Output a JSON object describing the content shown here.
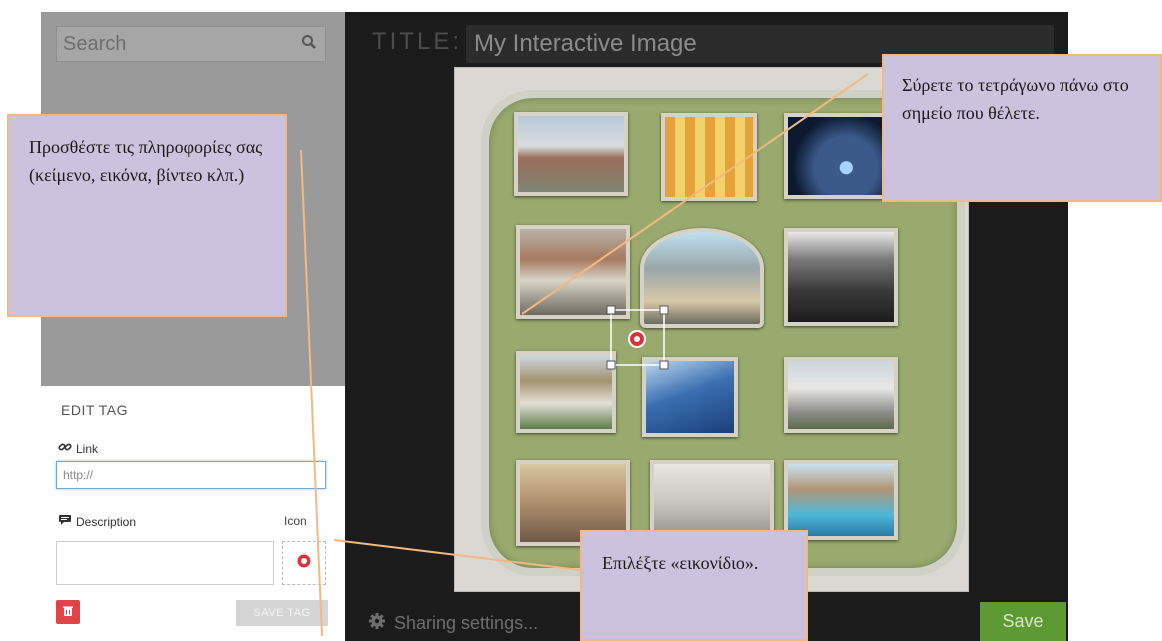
{
  "search": {
    "placeholder": "Search",
    "icon": "search-icon"
  },
  "edit_tag": {
    "heading": "EDIT TAG",
    "link_label": "Link",
    "link_value": "http://",
    "description_label": "Description",
    "description_value": "",
    "icon_label": "Icon",
    "save_label": "SAVE TAG"
  },
  "editor": {
    "title_label": "TITLE:",
    "title_value": "My Interactive Image",
    "sharing_label": "Sharing settings...",
    "save_label": "Save"
  },
  "callouts": {
    "left": "Προσθέστε τις πληροφορίες σας (κείμενο, εικόνα, βίντεο κλπ.)",
    "right": "Σύρετε το τετράγωνο πάνω στο σημείο που θέλετε.",
    "bottom": "Επιλέξτε «εικονίδιο»."
  },
  "colors": {
    "accent_green": "#5e9a34",
    "delete_red": "#e04448",
    "tag_red": "#d9343d",
    "callout_fill": "#cdc2dd",
    "callout_border": "#f3b982"
  }
}
